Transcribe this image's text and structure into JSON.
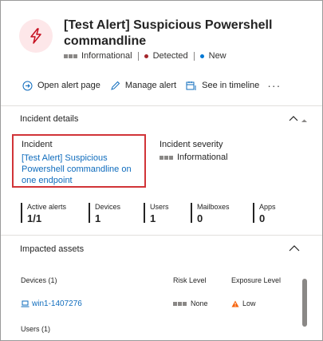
{
  "header": {
    "title": "[Test Alert] Suspicious Powershell commandline",
    "severity": "Informational",
    "status": "Detected",
    "state": "New",
    "colors": {
      "detected_dot": "#a4262c",
      "new_dot": "#0078d4",
      "icon_bg": "#fde7e9",
      "icon_stroke": "#c50f1f"
    }
  },
  "actions": {
    "open_alert_page": "Open alert page",
    "manage_alert": "Manage alert",
    "see_in_timeline": "See in timeline",
    "more": "···"
  },
  "incident_details": {
    "section_title": "Incident details",
    "incident_label": "Incident",
    "incident_link": "[Test Alert] Suspicious Powershell commandline on one endpoint",
    "severity_label": "Incident severity",
    "severity_value": "Informational"
  },
  "stats": [
    {
      "label": "Active alerts",
      "value": "1/1"
    },
    {
      "label": "Devices",
      "value": "1"
    },
    {
      "label": "Users",
      "value": "1"
    },
    {
      "label": "Mailboxes",
      "value": "0"
    },
    {
      "label": "Apps",
      "value": "0"
    }
  ],
  "impacted_assets": {
    "section_title": "Impacted assets",
    "columns": {
      "devices": "Devices (1)",
      "risk": "Risk Level",
      "exposure": "Exposure Level"
    },
    "device_row": {
      "name": "win1-1407276",
      "risk": "None",
      "exposure": "Low"
    },
    "users_label": "Users (1)",
    "colors": {
      "warning": "#f7630c",
      "link": "#0f6cbd"
    }
  }
}
